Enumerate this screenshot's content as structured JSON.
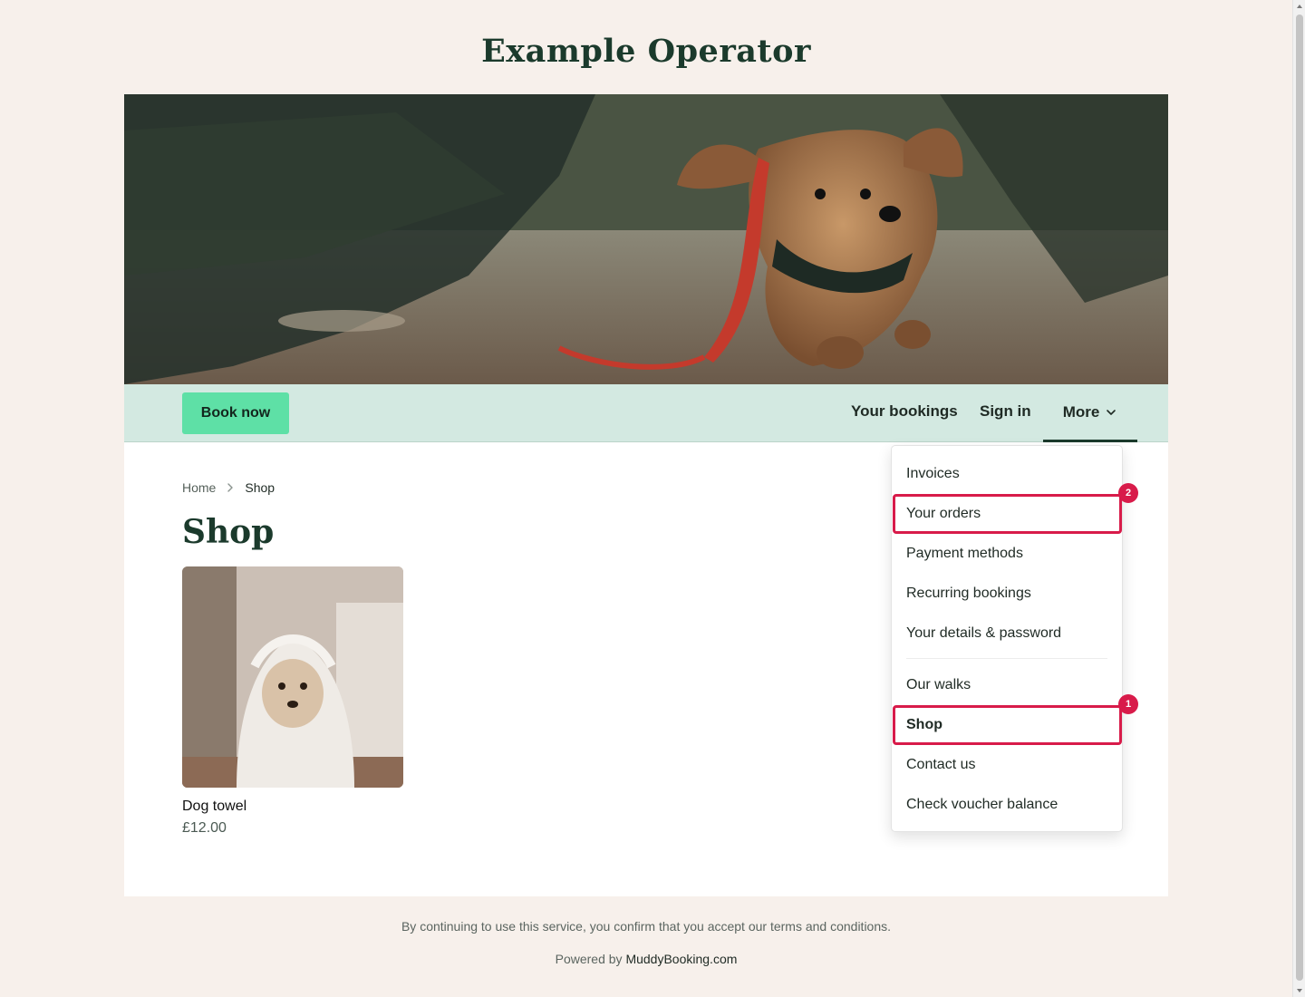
{
  "site": {
    "title": "Example Operator"
  },
  "nav": {
    "book_now": "Book now",
    "your_bookings": "Your bookings",
    "sign_in": "Sign in",
    "more": "More"
  },
  "breadcrumb": {
    "home": "Home",
    "current": "Shop"
  },
  "page": {
    "title": "Shop"
  },
  "products": [
    {
      "name": "Dog towel",
      "price": "£12.00"
    }
  ],
  "dropdown": {
    "items": [
      {
        "label": "Invoices"
      },
      {
        "label": "Your orders",
        "badge": "2"
      },
      {
        "label": "Payment methods"
      },
      {
        "label": "Recurring bookings"
      },
      {
        "label": "Your details & password"
      },
      {
        "label": "Our walks"
      },
      {
        "label": "Shop",
        "badge": "1"
      },
      {
        "label": "Contact us"
      },
      {
        "label": "Check voucher balance"
      }
    ]
  },
  "footer": {
    "terms": "By continuing to use this service, you confirm that you accept our terms and conditions.",
    "powered_by": "Powered by",
    "powered_link": "MuddyBooking.com"
  },
  "colors": {
    "background": "#f7f0eb",
    "brand_dark": "#1b3a2c",
    "accent_button": "#5ee0a6",
    "nav_bar": "#d3e9e1",
    "highlight": "#d81b4a"
  },
  "icons": {
    "more_chevron": "chevron-down-icon",
    "breadcrumb_separator": "chevron-right-icon"
  }
}
